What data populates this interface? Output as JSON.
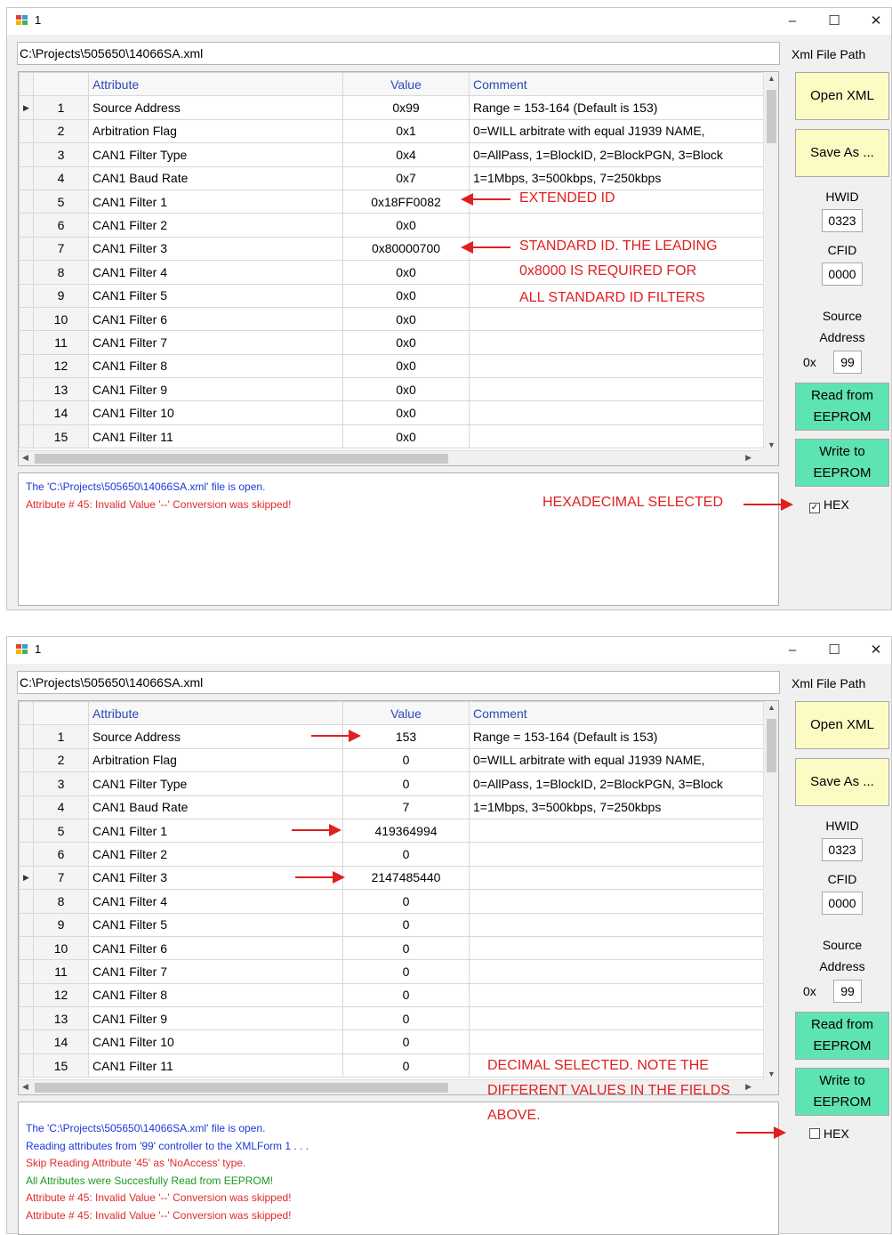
{
  "colors": {
    "accent_blue": "#2b49b5",
    "log_blue": "#1d38d8",
    "log_red": "#e02a2a",
    "log_green": "#1c9b1c",
    "annotation_red": "#e02020",
    "button_yellow": "#fdfbc4",
    "button_green": "#5ee3b2"
  },
  "windows": [
    {
      "title": "1",
      "path": "C:\\Projects\\505650\\14066SA.xml",
      "xml_label": "Xml File Path",
      "columns": {
        "attribute": "Attribute",
        "value": "Value",
        "comment": "Comment"
      },
      "selected_row": 1,
      "rows": [
        {
          "num": "1",
          "attr": "Source Address",
          "value": "0x99",
          "comment": "Range = 153-164 (Default is 153)"
        },
        {
          "num": "2",
          "attr": "Arbitration Flag",
          "value": "0x1",
          "comment": "0=WILL arbitrate with equal J1939 NAME,"
        },
        {
          "num": "3",
          "attr": "CAN1 Filter Type",
          "value": "0x4",
          "comment": "0=AllPass, 1=BlockID, 2=BlockPGN, 3=Block"
        },
        {
          "num": "4",
          "attr": "CAN1 Baud Rate",
          "value": "0x7",
          "comment": "1=1Mbps, 3=500kbps, 7=250kbps"
        },
        {
          "num": "5",
          "attr": "CAN1 Filter 1",
          "value": "0x18FF0082",
          "comment": ""
        },
        {
          "num": "6",
          "attr": "CAN1 Filter 2",
          "value": "0x0",
          "comment": ""
        },
        {
          "num": "7",
          "attr": "CAN1 Filter 3",
          "value": "0x80000700",
          "comment": ""
        },
        {
          "num": "8",
          "attr": "CAN1 Filter 4",
          "value": "0x0",
          "comment": ""
        },
        {
          "num": "9",
          "attr": "CAN1 Filter 5",
          "value": "0x0",
          "comment": ""
        },
        {
          "num": "10",
          "attr": "CAN1 Filter 6",
          "value": "0x0",
          "comment": ""
        },
        {
          "num": "11",
          "attr": "CAN1 Filter 7",
          "value": "0x0",
          "comment": ""
        },
        {
          "num": "12",
          "attr": "CAN1 Filter 8",
          "value": "0x0",
          "comment": ""
        },
        {
          "num": "13",
          "attr": "CAN1 Filter 9",
          "value": "0x0",
          "comment": ""
        },
        {
          "num": "14",
          "attr": "CAN1 Filter 10",
          "value": "0x0",
          "comment": ""
        },
        {
          "num": "15",
          "attr": "CAN1 Filter 11",
          "value": "0x0",
          "comment": ""
        }
      ],
      "buttons": {
        "open": "Open XML",
        "save": "Save As ...",
        "read_l1": "Read from",
        "read_l2": "EEPROM",
        "write_l1": "Write to",
        "write_l2": "EEPROM"
      },
      "hwid_label": "HWID",
      "hwid": "0323",
      "cfid_label": "CFID",
      "cfid": "0000",
      "sa_label_1": "Source",
      "sa_label_2": "Address",
      "sa_prefix": "0x",
      "sa_value": "99",
      "hex_label": "HEX",
      "hex_checked": true,
      "hex_mark": "✓",
      "log": [
        {
          "text": "The 'C:\\Projects\\505650\\14066SA.xml' file is open.",
          "color": "blue"
        },
        {
          "text": "Attribute # 45: Invalid Value '--' Conversion was skipped!",
          "color": "red"
        }
      ],
      "annotations": [
        "EXTENDED ID",
        "STANDARD ID. THE LEADING",
        "0x8000 IS REQUIRED FOR",
        "ALL STANDARD ID FILTERS",
        "HEXADECIMAL SELECTED"
      ]
    },
    {
      "title": "1",
      "path": "C:\\Projects\\505650\\14066SA.xml",
      "xml_label": "Xml File Path",
      "columns": {
        "attribute": "Attribute",
        "value": "Value",
        "comment": "Comment"
      },
      "selected_row": 7,
      "rows": [
        {
          "num": "1",
          "attr": "Source Address",
          "value": "153",
          "comment": "Range = 153-164 (Default is 153)"
        },
        {
          "num": "2",
          "attr": "Arbitration Flag",
          "value": "0",
          "comment": "0=WILL arbitrate with equal J1939 NAME,"
        },
        {
          "num": "3",
          "attr": "CAN1 Filter Type",
          "value": "0",
          "comment": "0=AllPass, 1=BlockID, 2=BlockPGN, 3=Block"
        },
        {
          "num": "4",
          "attr": "CAN1 Baud Rate",
          "value": "7",
          "comment": "1=1Mbps, 3=500kbps, 7=250kbps"
        },
        {
          "num": "5",
          "attr": "CAN1 Filter 1",
          "value": "419364994",
          "comment": ""
        },
        {
          "num": "6",
          "attr": "CAN1 Filter 2",
          "value": "0",
          "comment": ""
        },
        {
          "num": "7",
          "attr": "CAN1 Filter 3",
          "value": "2147485440",
          "comment": ""
        },
        {
          "num": "8",
          "attr": "CAN1 Filter 4",
          "value": "0",
          "comment": ""
        },
        {
          "num": "9",
          "attr": "CAN1 Filter 5",
          "value": "0",
          "comment": ""
        },
        {
          "num": "10",
          "attr": "CAN1 Filter 6",
          "value": "0",
          "comment": ""
        },
        {
          "num": "11",
          "attr": "CAN1 Filter 7",
          "value": "0",
          "comment": ""
        },
        {
          "num": "12",
          "attr": "CAN1 Filter 8",
          "value": "0",
          "comment": ""
        },
        {
          "num": "13",
          "attr": "CAN1 Filter 9",
          "value": "0",
          "comment": ""
        },
        {
          "num": "14",
          "attr": "CAN1 Filter 10",
          "value": "0",
          "comment": ""
        },
        {
          "num": "15",
          "attr": "CAN1 Filter 11",
          "value": "0",
          "comment": ""
        }
      ],
      "buttons": {
        "open": "Open XML",
        "save": "Save As ...",
        "read_l1": "Read from",
        "read_l2": "EEPROM",
        "write_l1": "Write to",
        "write_l2": "EEPROM"
      },
      "hwid_label": "HWID",
      "hwid": "0323",
      "cfid_label": "CFID",
      "cfid": "0000",
      "sa_label_1": "Source",
      "sa_label_2": "Address",
      "sa_prefix": "0x",
      "sa_value": "99",
      "hex_label": "HEX",
      "hex_checked": false,
      "hex_mark": "",
      "log": [
        {
          "text": "The 'C:\\Projects\\505650\\14066SA.xml' file is open.",
          "color": "blue"
        },
        {
          "text": "Reading attributes from '99' controller to the XMLForm 1 . . .",
          "color": "blue"
        },
        {
          "text": "Skip Reading Attribute '45' as 'NoAccess' type.",
          "color": "red"
        },
        {
          "text": "All Attributes were Succesfully Read from EEPROM!",
          "color": "green"
        },
        {
          "text": "Attribute # 45: Invalid Value '--' Conversion was skipped!",
          "color": "red"
        },
        {
          "text": "Attribute # 45: Invalid Value '--' Conversion was skipped!",
          "color": "red"
        }
      ],
      "annotations": [
        "DECIMAL SELECTED. NOTE THE",
        "DIFFERENT VALUES IN THE FIELDS",
        "ABOVE."
      ]
    }
  ]
}
